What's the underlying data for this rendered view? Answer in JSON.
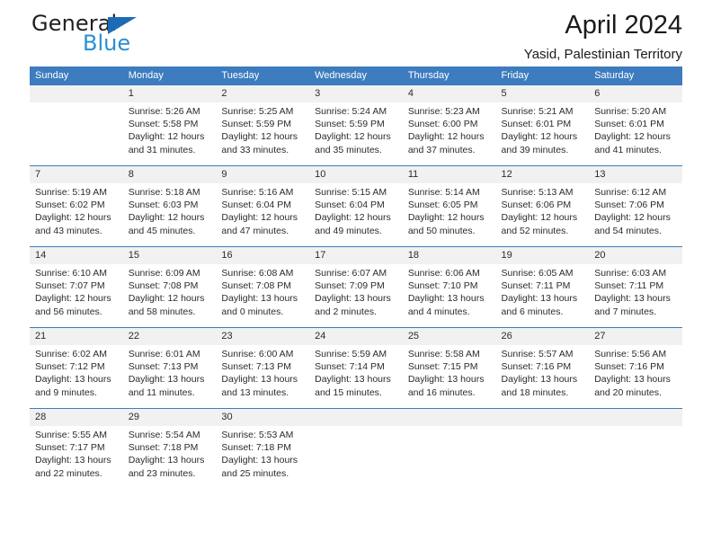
{
  "brand": {
    "word_one": "General",
    "word_two": "Blue",
    "triangle_icon": "triangle-icon",
    "blue": "#2a8fd4",
    "dark_blue": "#1b6cb5"
  },
  "header": {
    "title": "April 2024",
    "subtitle": "Yasid, Palestinian Territory"
  },
  "colors": {
    "header_blue": "#3d7cbf",
    "daynum_band": "#f1f1f1",
    "text": "#2b2b2b"
  },
  "weekday_headers": [
    "Sunday",
    "Monday",
    "Tuesday",
    "Wednesday",
    "Thursday",
    "Friday",
    "Saturday"
  ],
  "weeks": [
    [
      {
        "day": "",
        "lines": []
      },
      {
        "day": "1",
        "lines": [
          "Sunrise: 5:26 AM",
          "Sunset: 5:58 PM",
          "Daylight: 12 hours",
          "and 31 minutes."
        ]
      },
      {
        "day": "2",
        "lines": [
          "Sunrise: 5:25 AM",
          "Sunset: 5:59 PM",
          "Daylight: 12 hours",
          "and 33 minutes."
        ]
      },
      {
        "day": "3",
        "lines": [
          "Sunrise: 5:24 AM",
          "Sunset: 5:59 PM",
          "Daylight: 12 hours",
          "and 35 minutes."
        ]
      },
      {
        "day": "4",
        "lines": [
          "Sunrise: 5:23 AM",
          "Sunset: 6:00 PM",
          "Daylight: 12 hours",
          "and 37 minutes."
        ]
      },
      {
        "day": "5",
        "lines": [
          "Sunrise: 5:21 AM",
          "Sunset: 6:01 PM",
          "Daylight: 12 hours",
          "and 39 minutes."
        ]
      },
      {
        "day": "6",
        "lines": [
          "Sunrise: 5:20 AM",
          "Sunset: 6:01 PM",
          "Daylight: 12 hours",
          "and 41 minutes."
        ]
      }
    ],
    [
      {
        "day": "7",
        "lines": [
          "Sunrise: 5:19 AM",
          "Sunset: 6:02 PM",
          "Daylight: 12 hours",
          "and 43 minutes."
        ]
      },
      {
        "day": "8",
        "lines": [
          "Sunrise: 5:18 AM",
          "Sunset: 6:03 PM",
          "Daylight: 12 hours",
          "and 45 minutes."
        ]
      },
      {
        "day": "9",
        "lines": [
          "Sunrise: 5:16 AM",
          "Sunset: 6:04 PM",
          "Daylight: 12 hours",
          "and 47 minutes."
        ]
      },
      {
        "day": "10",
        "lines": [
          "Sunrise: 5:15 AM",
          "Sunset: 6:04 PM",
          "Daylight: 12 hours",
          "and 49 minutes."
        ]
      },
      {
        "day": "11",
        "lines": [
          "Sunrise: 5:14 AM",
          "Sunset: 6:05 PM",
          "Daylight: 12 hours",
          "and 50 minutes."
        ]
      },
      {
        "day": "12",
        "lines": [
          "Sunrise: 5:13 AM",
          "Sunset: 6:06 PM",
          "Daylight: 12 hours",
          "and 52 minutes."
        ]
      },
      {
        "day": "13",
        "lines": [
          "Sunrise: 6:12 AM",
          "Sunset: 7:06 PM",
          "Daylight: 12 hours",
          "and 54 minutes."
        ]
      }
    ],
    [
      {
        "day": "14",
        "lines": [
          "Sunrise: 6:10 AM",
          "Sunset: 7:07 PM",
          "Daylight: 12 hours",
          "and 56 minutes."
        ]
      },
      {
        "day": "15",
        "lines": [
          "Sunrise: 6:09 AM",
          "Sunset: 7:08 PM",
          "Daylight: 12 hours",
          "and 58 minutes."
        ]
      },
      {
        "day": "16",
        "lines": [
          "Sunrise: 6:08 AM",
          "Sunset: 7:08 PM",
          "Daylight: 13 hours",
          "and 0 minutes."
        ]
      },
      {
        "day": "17",
        "lines": [
          "Sunrise: 6:07 AM",
          "Sunset: 7:09 PM",
          "Daylight: 13 hours",
          "and 2 minutes."
        ]
      },
      {
        "day": "18",
        "lines": [
          "Sunrise: 6:06 AM",
          "Sunset: 7:10 PM",
          "Daylight: 13 hours",
          "and 4 minutes."
        ]
      },
      {
        "day": "19",
        "lines": [
          "Sunrise: 6:05 AM",
          "Sunset: 7:11 PM",
          "Daylight: 13 hours",
          "and 6 minutes."
        ]
      },
      {
        "day": "20",
        "lines": [
          "Sunrise: 6:03 AM",
          "Sunset: 7:11 PM",
          "Daylight: 13 hours",
          "and 7 minutes."
        ]
      }
    ],
    [
      {
        "day": "21",
        "lines": [
          "Sunrise: 6:02 AM",
          "Sunset: 7:12 PM",
          "Daylight: 13 hours",
          "and 9 minutes."
        ]
      },
      {
        "day": "22",
        "lines": [
          "Sunrise: 6:01 AM",
          "Sunset: 7:13 PM",
          "Daylight: 13 hours",
          "and 11 minutes."
        ]
      },
      {
        "day": "23",
        "lines": [
          "Sunrise: 6:00 AM",
          "Sunset: 7:13 PM",
          "Daylight: 13 hours",
          "and 13 minutes."
        ]
      },
      {
        "day": "24",
        "lines": [
          "Sunrise: 5:59 AM",
          "Sunset: 7:14 PM",
          "Daylight: 13 hours",
          "and 15 minutes."
        ]
      },
      {
        "day": "25",
        "lines": [
          "Sunrise: 5:58 AM",
          "Sunset: 7:15 PM",
          "Daylight: 13 hours",
          "and 16 minutes."
        ]
      },
      {
        "day": "26",
        "lines": [
          "Sunrise: 5:57 AM",
          "Sunset: 7:16 PM",
          "Daylight: 13 hours",
          "and 18 minutes."
        ]
      },
      {
        "day": "27",
        "lines": [
          "Sunrise: 5:56 AM",
          "Sunset: 7:16 PM",
          "Daylight: 13 hours",
          "and 20 minutes."
        ]
      }
    ],
    [
      {
        "day": "28",
        "lines": [
          "Sunrise: 5:55 AM",
          "Sunset: 7:17 PM",
          "Daylight: 13 hours",
          "and 22 minutes."
        ]
      },
      {
        "day": "29",
        "lines": [
          "Sunrise: 5:54 AM",
          "Sunset: 7:18 PM",
          "Daylight: 13 hours",
          "and 23 minutes."
        ]
      },
      {
        "day": "30",
        "lines": [
          "Sunrise: 5:53 AM",
          "Sunset: 7:18 PM",
          "Daylight: 13 hours",
          "and 25 minutes."
        ]
      },
      {
        "day": "",
        "lines": []
      },
      {
        "day": "",
        "lines": []
      },
      {
        "day": "",
        "lines": []
      },
      {
        "day": "",
        "lines": []
      }
    ]
  ]
}
